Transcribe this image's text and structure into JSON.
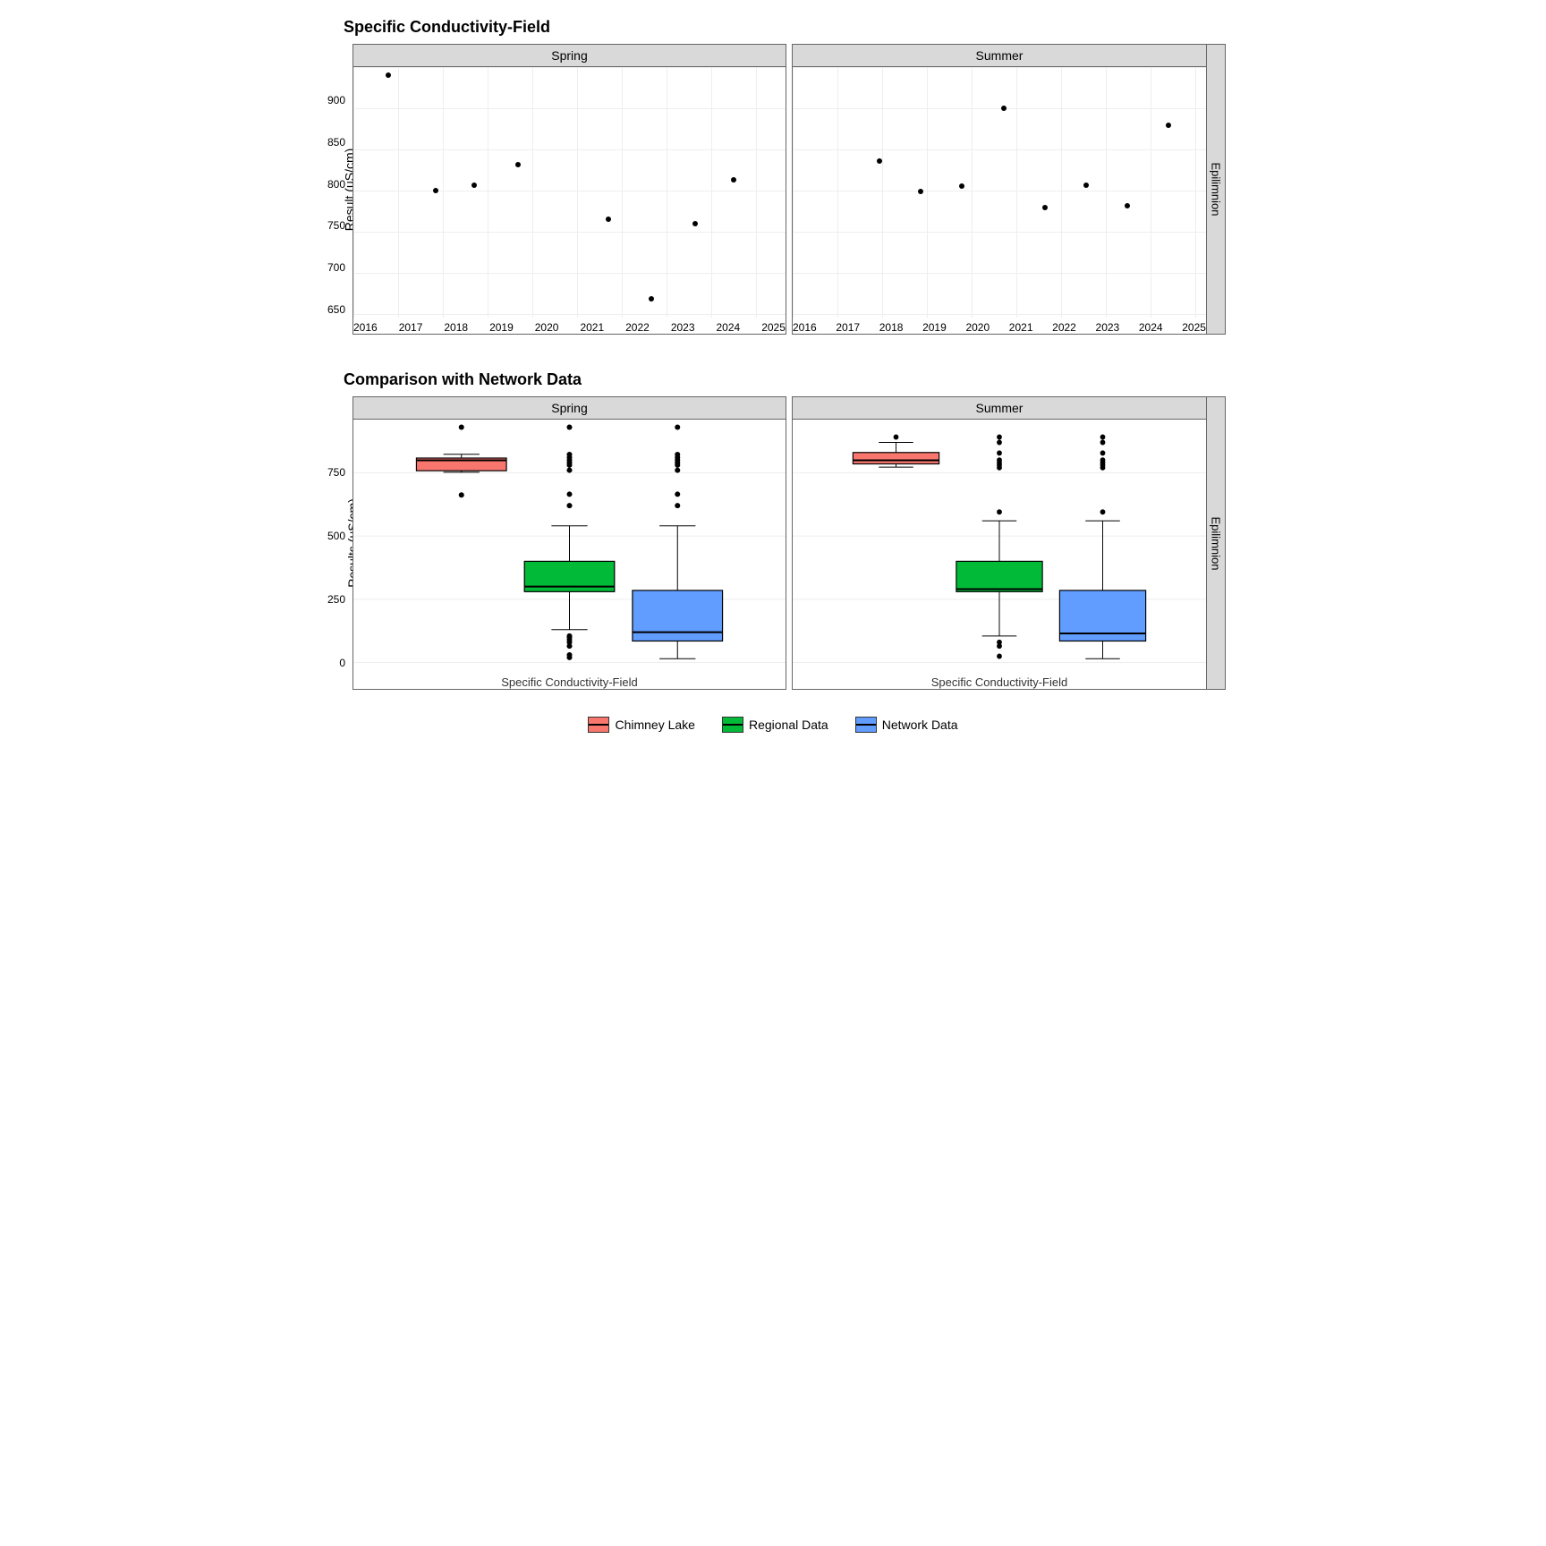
{
  "chart_data": [
    {
      "type": "scatter",
      "title": "Specific Conductivity-Field",
      "ylabel": "Result (uS/cm)",
      "ylim": [
        640,
        940
      ],
      "yticks": [
        650,
        700,
        750,
        800,
        850,
        900
      ],
      "xlim": [
        2015.5,
        2025.5
      ],
      "xticks": [
        2016,
        2017,
        2018,
        2019,
        2020,
        2021,
        2022,
        2023,
        2024,
        2025
      ],
      "facet_right": "Epilimnion",
      "facets": [
        {
          "name": "Spring",
          "points": [
            {
              "x": 2016.3,
              "y": 930
            },
            {
              "x": 2017.4,
              "y": 792
            },
            {
              "x": 2018.3,
              "y": 799
            },
            {
              "x": 2019.3,
              "y": 823
            },
            {
              "x": 2021.4,
              "y": 758
            },
            {
              "x": 2022.4,
              "y": 662
            },
            {
              "x": 2023.4,
              "y": 752
            },
            {
              "x": 2024.3,
              "y": 805
            }
          ]
        },
        {
          "name": "Summer",
          "points": [
            {
              "x": 2017.6,
              "y": 828
            },
            {
              "x": 2018.6,
              "y": 791
            },
            {
              "x": 2019.6,
              "y": 798
            },
            {
              "x": 2020.6,
              "y": 891
            },
            {
              "x": 2021.6,
              "y": 772
            },
            {
              "x": 2022.6,
              "y": 799
            },
            {
              "x": 2023.6,
              "y": 774
            },
            {
              "x": 2024.6,
              "y": 870
            }
          ]
        }
      ]
    },
    {
      "type": "boxplot",
      "title": "Comparison with Network Data",
      "ylabel": "Results (uS/cm)",
      "ylim": [
        -30,
        960
      ],
      "yticks": [
        0,
        250,
        500,
        750
      ],
      "x_category_label": "Specific Conductivity-Field",
      "facet_right": "Epilimnion",
      "legend": [
        {
          "name": "Chimney Lake",
          "color": "#F8766D"
        },
        {
          "name": "Regional Data",
          "color": "#00BA38"
        },
        {
          "name": "Network Data",
          "color": "#619CFF"
        }
      ],
      "facets": [
        {
          "name": "Spring",
          "boxes": [
            {
              "series": "Chimney Lake",
              "color": "#F8766D",
              "min": 752,
              "q1": 758,
              "med": 799,
              "q3": 808,
              "max": 823,
              "outliers": [
                662,
                930
              ]
            },
            {
              "series": "Regional Data",
              "color": "#00BA38",
              "min": 130,
              "q1": 280,
              "med": 300,
              "q3": 400,
              "max": 540,
              "outliers": [
                20,
                30,
                65,
                80,
                90,
                100,
                105,
                620,
                665,
                760,
                780,
                790,
                800,
                810,
                822,
                930
              ]
            },
            {
              "series": "Network Data",
              "color": "#619CFF",
              "min": 15,
              "q1": 85,
              "med": 120,
              "q3": 285,
              "max": 540,
              "outliers": [
                620,
                665,
                760,
                780,
                790,
                800,
                810,
                822,
                930
              ]
            }
          ]
        },
        {
          "name": "Summer",
          "boxes": [
            {
              "series": "Chimney Lake",
              "color": "#F8766D",
              "min": 772,
              "q1": 785,
              "med": 799,
              "q3": 830,
              "max": 870,
              "outliers": [
                891
              ]
            },
            {
              "series": "Regional Data",
              "color": "#00BA38",
              "min": 105,
              "q1": 280,
              "med": 290,
              "q3": 400,
              "max": 560,
              "outliers": [
                25,
                65,
                80,
                595,
                770,
                780,
                790,
                800,
                828,
                870,
                891
              ]
            },
            {
              "series": "Network Data",
              "color": "#619CFF",
              "min": 15,
              "q1": 85,
              "med": 115,
              "q3": 285,
              "max": 560,
              "outliers": [
                595,
                770,
                780,
                790,
                800,
                828,
                870,
                891
              ]
            }
          ]
        }
      ]
    }
  ]
}
